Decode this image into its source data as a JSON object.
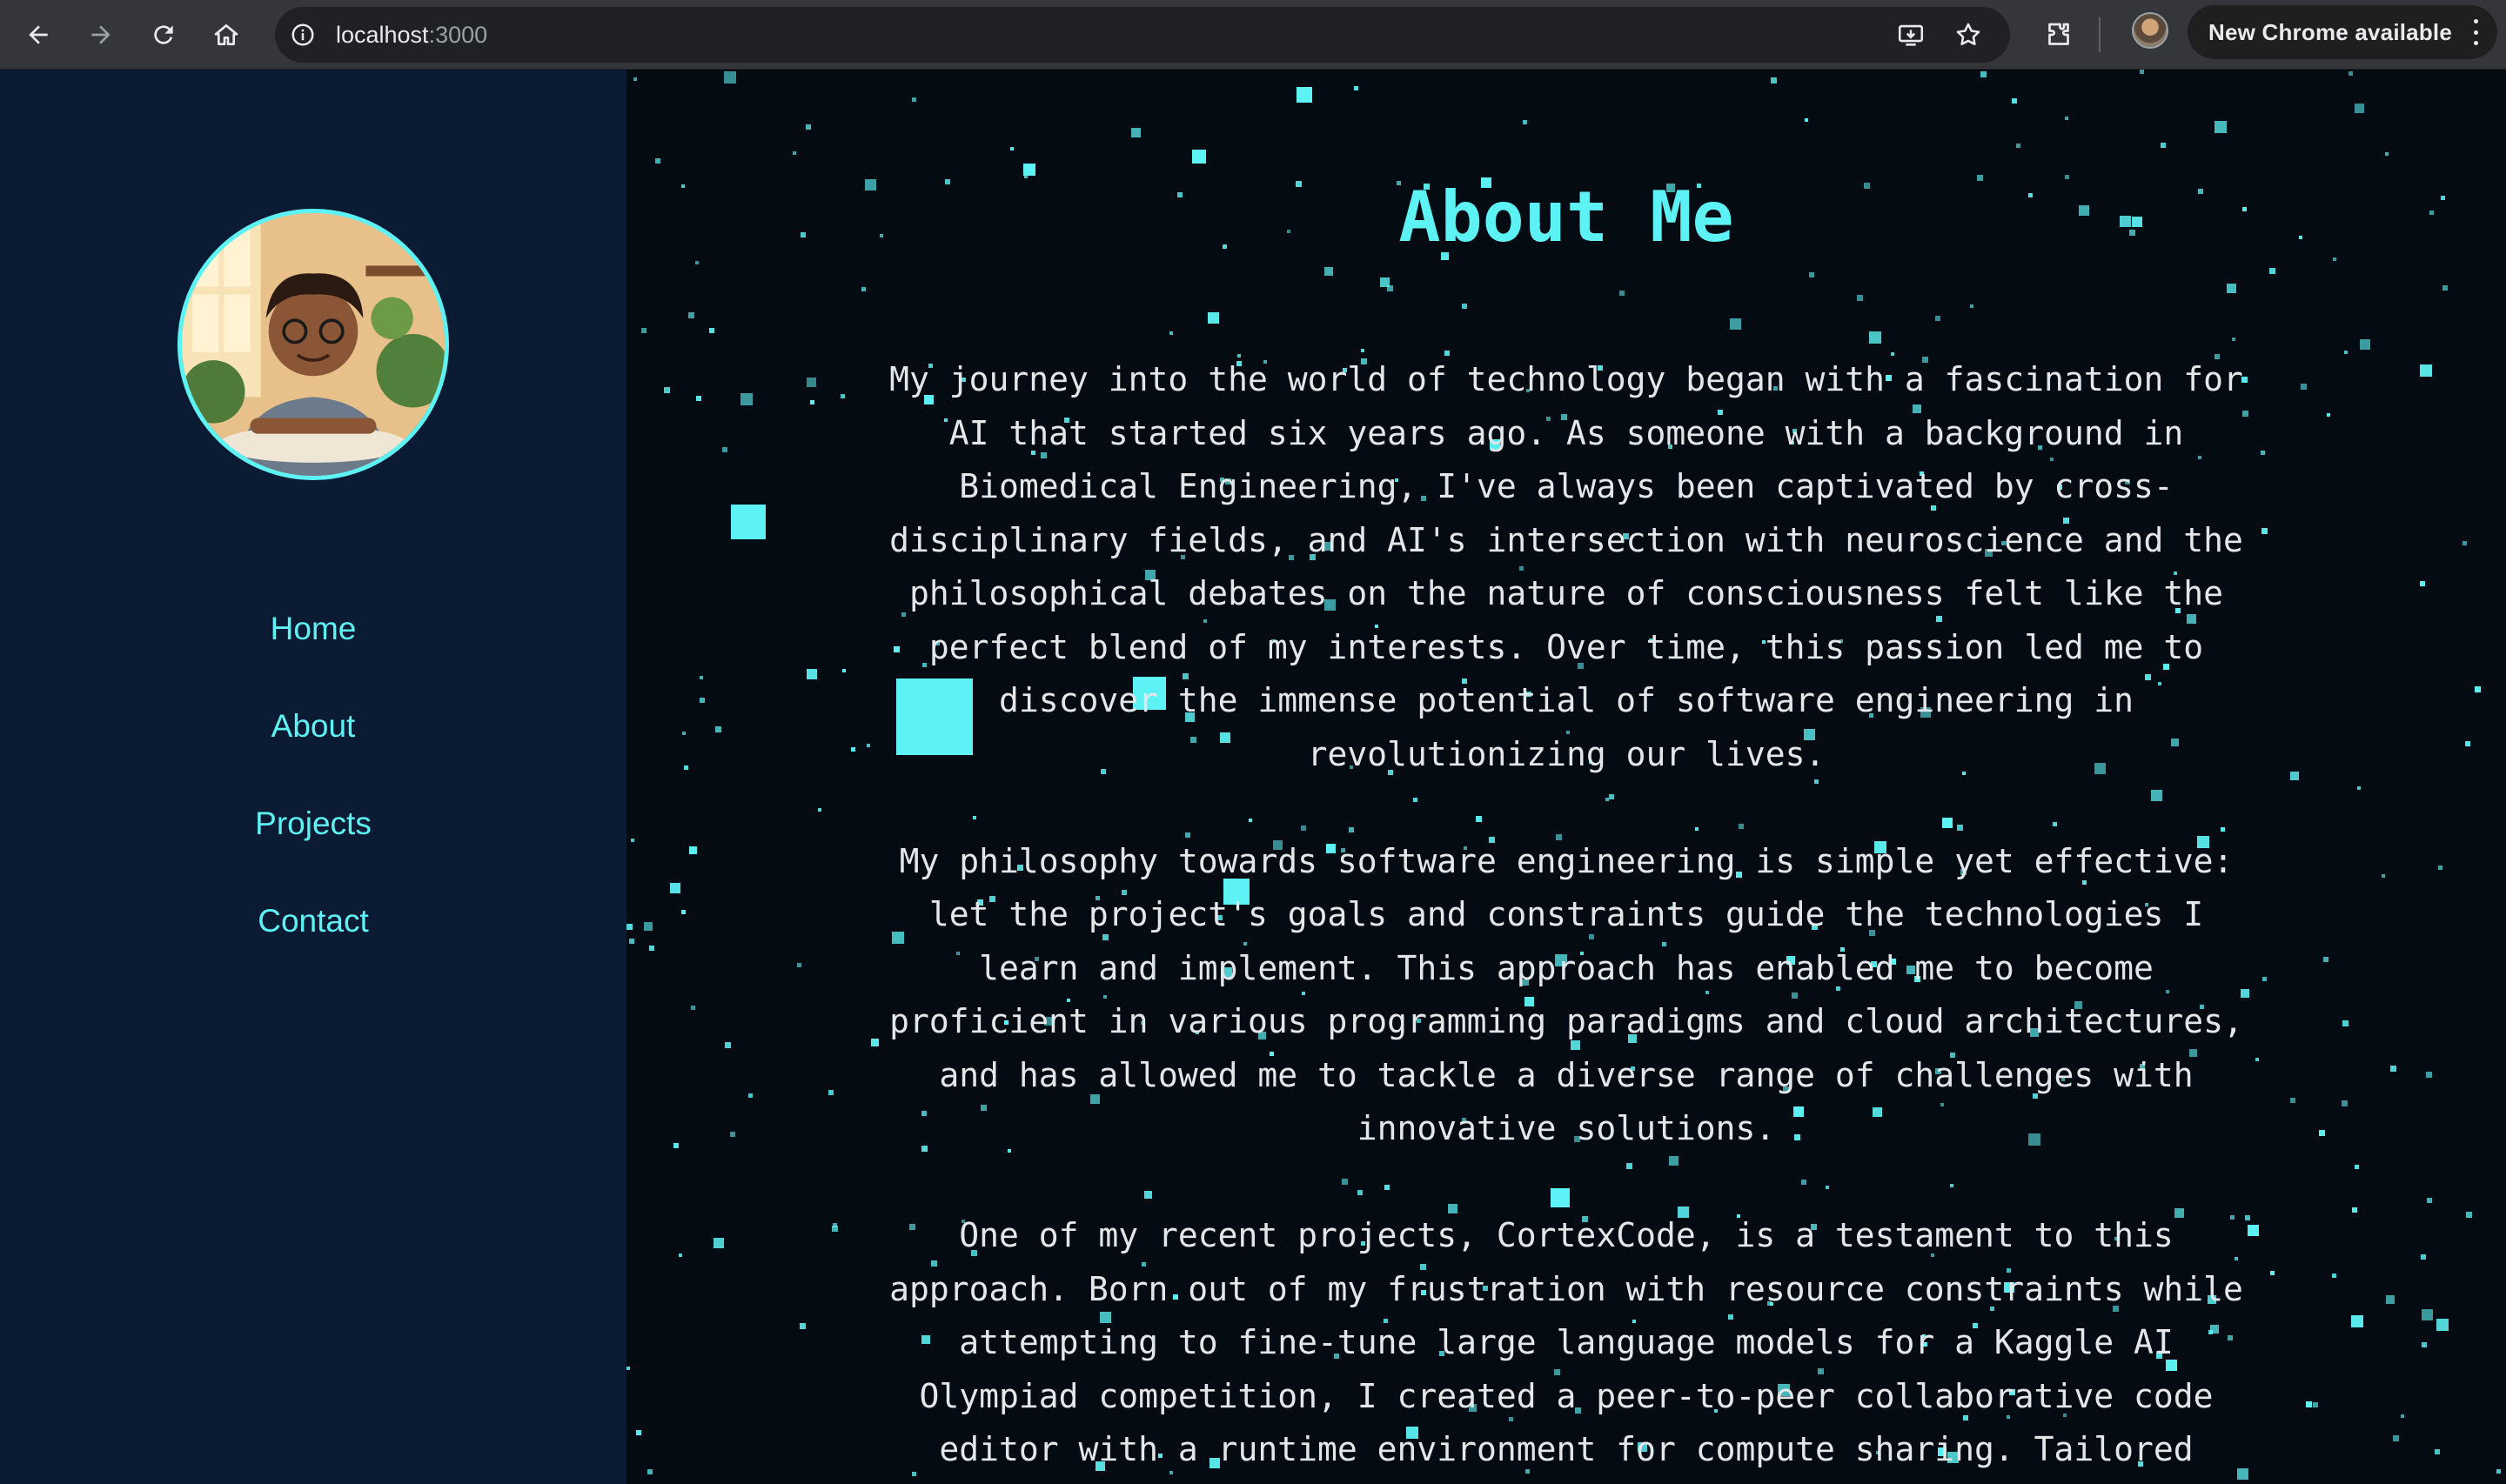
{
  "browser": {
    "url_host": "localhost",
    "url_port": ":3000",
    "update_label": "New Chrome available"
  },
  "sidebar": {
    "nav": [
      {
        "label": "Home"
      },
      {
        "label": "About"
      },
      {
        "label": "Projects"
      },
      {
        "label": "Contact"
      }
    ]
  },
  "main": {
    "title": "About Me",
    "paragraphs": [
      "My journey into the world of technology began with a fascination for AI that started six years ago. As someone with a background in Biomedical Engineering, I've always been captivated by cross-disciplinary fields, and AI's intersection with neuroscience and the philosophical debates on the nature of consciousness felt like the perfect blend of my interests. Over time, this passion led me to discover the immense potential of software engineering in revolutionizing our lives.",
      "My philosophy towards software engineering is simple yet effective: let the project's goals and constraints guide the technologies I learn and implement. This approach has enabled me to become proficient in various programming paradigms and cloud architectures, and has allowed me to tackle a diverse range of challenges with innovative solutions.",
      "One of my recent projects, CortexCode, is a testament to this approach. Born out of my frustration with resource constraints while attempting to fine-tune large language models for a Kaggle AI Olympiad competition, I created a peer-to-peer collaborative code editor with a runtime environment for compute sharing. Tailored"
    ]
  },
  "colors": {
    "accent": "#5df3f5",
    "sidebar_bg": "#0a1b33",
    "main_bg": "#050b13",
    "text": "#e4e7ea"
  }
}
